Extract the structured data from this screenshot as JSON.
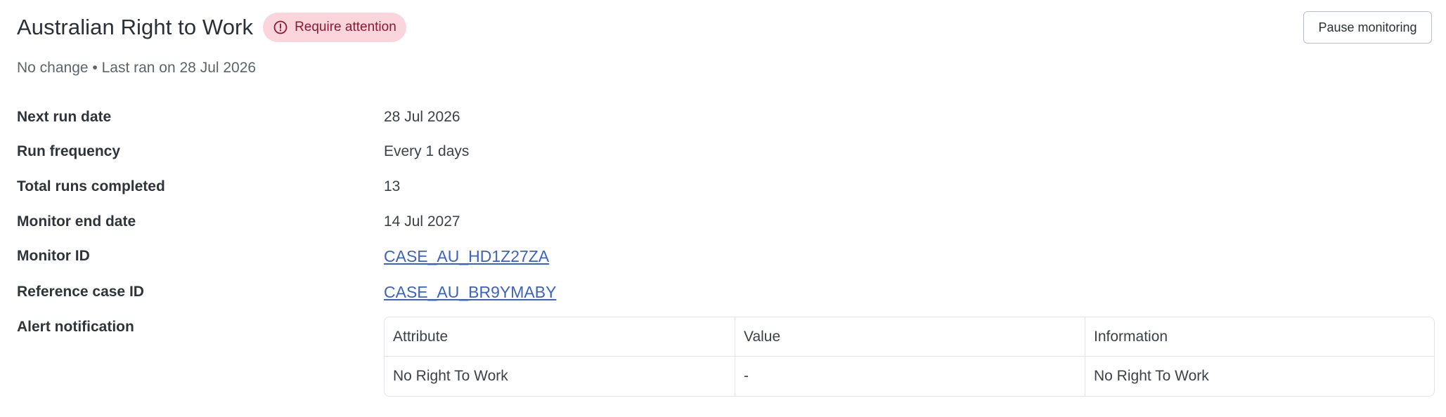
{
  "header": {
    "title": "Australian Right to Work",
    "status_badge": "Require attention",
    "status_icon": "alert-circle-icon",
    "status_color": "#8e1731",
    "status_bg": "#fbd5dc",
    "pause_button": "Pause monitoring"
  },
  "subtitle": "No change • Last ran on 28 Jul 2026",
  "details": {
    "next_run_date": {
      "label": "Next run date",
      "value": "28 Jul 2026"
    },
    "run_frequency": {
      "label": "Run frequency",
      "value": "Every 1 days"
    },
    "total_runs": {
      "label": "Total runs completed",
      "value": "13"
    },
    "monitor_end_date": {
      "label": "Monitor end date",
      "value": "14 Jul 2027"
    },
    "monitor_id": {
      "label": "Monitor ID",
      "value": "CASE_AU_HD1Z27ZA"
    },
    "reference_case_id": {
      "label": "Reference case ID",
      "value": "CASE_AU_BR9YMABY"
    },
    "alert_notification": {
      "label": "Alert notification"
    }
  },
  "alert_table": {
    "columns": [
      "Attribute",
      "Value",
      "Information"
    ],
    "rows": [
      [
        "No Right To Work",
        "-",
        "No Right To Work"
      ]
    ]
  },
  "colors": {
    "link": "#3a63c4",
    "border": "#e1e4e8"
  }
}
